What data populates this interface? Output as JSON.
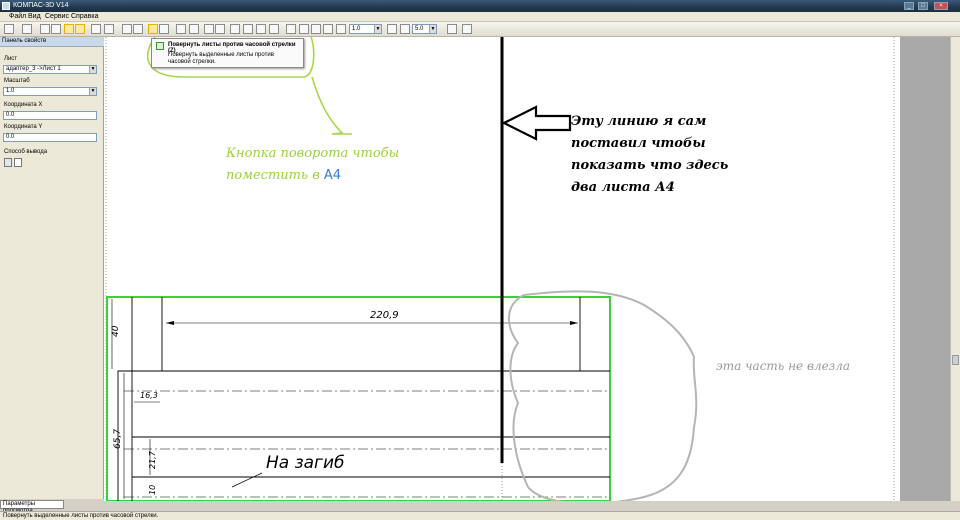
{
  "window": {
    "title": "КОМПАС-3D V14"
  },
  "menu": [
    "Файл",
    "Вид",
    "Сервис",
    "Справка"
  ],
  "toolbar": {
    "zoom_value": "1.0",
    "step_value": "5.0"
  },
  "tooltip": {
    "title": "Повернуть листы против часовой стрелки (Z)",
    "description": "Повернуть выделенные листы против часовой стрелки."
  },
  "panel": {
    "title": "Панель свойств",
    "sheet_label": "Лист",
    "sheet_value": "адаптер_3 ->Лист 1",
    "scale_label": "Масштаб",
    "scale_value": "1.0",
    "x_label": "Координата X",
    "x_value": "0.0",
    "y_label": "Координата Y",
    "y_value": "0.0",
    "output_label": "Способ вывода",
    "tab_label": "Параметры просмотра"
  },
  "drawing": {
    "dim_top": "220,9",
    "dim_left_top": "40",
    "dim_small": "16,3",
    "dim_left_mid": "65,7",
    "dim_mid2": "21,7",
    "dim_bottom": "10",
    "bend_label": "На загиб"
  },
  "notes": {
    "green_line1": "Кнопка поворота чтобы",
    "green_line2": "поместить в",
    "green_a4": "А4",
    "black_lines": [
      "Эту линию я сам",
      "поставил чтобы",
      "показать  что здесь",
      "два листа А4"
    ],
    "gray": "эта часть не влезла"
  },
  "status": {
    "text": "Повернуть выделенные листы против часовой стрелки."
  },
  "colors": {
    "annotation_green": "#9bd23a",
    "a4_blue": "#2f7fd9",
    "sheet_border_green": "#3ad23a"
  }
}
